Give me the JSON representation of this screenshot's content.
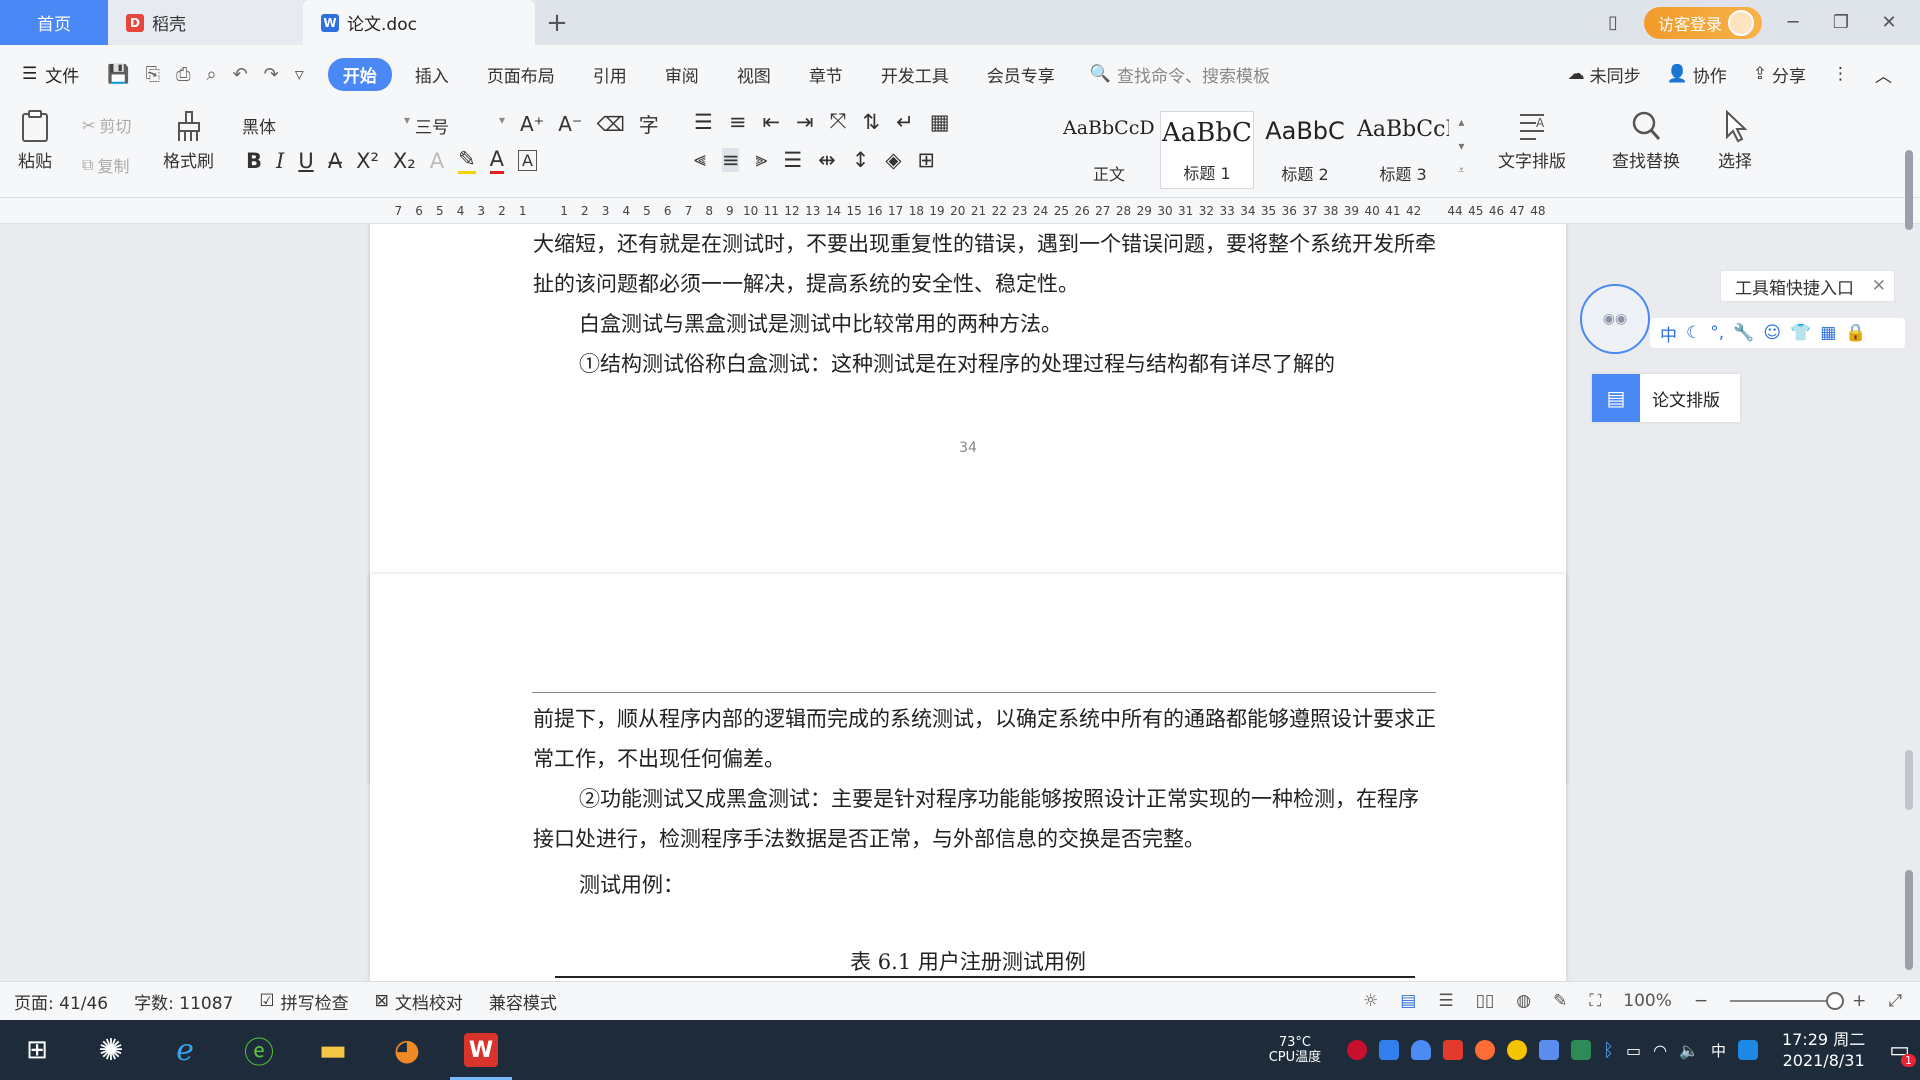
{
  "tabs": {
    "home": "首页",
    "docer": "稻壳",
    "doc": "论文.doc",
    "add": "+",
    "guest_login": "访客登录"
  },
  "menu": {
    "file": "文件",
    "tabs": [
      "开始",
      "插入",
      "页面布局",
      "引用",
      "审阅",
      "视图",
      "章节",
      "开发工具",
      "会员专享"
    ],
    "search_placeholder": "查找命令、搜索模板",
    "unsynced": "未同步",
    "collab": "协作",
    "share": "分享"
  },
  "ribbon": {
    "paste": "粘贴",
    "cut": "剪切",
    "copy": "复制",
    "format_painter": "格式刷",
    "font_name": "黑体",
    "font_size": "三号",
    "styles": [
      {
        "sample": "AaBbCcDc",
        "name": "正文"
      },
      {
        "sample": "AaBbC",
        "name": "标题 1"
      },
      {
        "sample": "AaBbC",
        "name": "标题 2"
      },
      {
        "sample": "AaBbCcI",
        "name": "标题 3"
      }
    ],
    "text_layout": "文字排版",
    "find_replace": "查找替换",
    "select": "选择"
  },
  "ruler": {
    "numbers": [
      "7",
      "6",
      "5",
      "4",
      "3",
      "2",
      "1",
      "",
      "1",
      "2",
      "3",
      "4",
      "5",
      "6",
      "7",
      "8",
      "9",
      "10",
      "11",
      "12",
      "13",
      "14",
      "15",
      "16",
      "17",
      "18",
      "19",
      "20",
      "21",
      "22",
      "23",
      "24",
      "25",
      "26",
      "27",
      "28",
      "29",
      "30",
      "31",
      "32",
      "33",
      "34",
      "35",
      "36",
      "37",
      "38",
      "39",
      "40",
      "41",
      "42",
      "",
      "44",
      "45",
      "46",
      "47",
      "48"
    ]
  },
  "document": {
    "page1_paragraphs": [
      "大缩短，还有就是在测试时，不要出现重复性的错误，遇到一个错误问题，要将整个系统开发所牵扯的该问题都必须一一解决，提高系统的安全性、稳定性。",
      "白盒测试与黑盒测试是测试中比较常用的两种方法。",
      "①结构测试俗称白盒测试：这种测试是在对程序的处理过程与结构都有详尽了解的"
    ],
    "page1_number": "34",
    "page2_paragraphs": [
      "前提下，顺从程序内部的逻辑而完成的系统测试，以确定系统中所有的通路都能够遵照设计要求正常工作，不出现任何偏差。",
      "②功能测试又成黑盒测试：主要是针对程序功能能够按照设计正常实现的一种检测，在程序接口处进行，检测程序手法数据是否正常，与外部信息的交换是否完整。",
      "测试用例："
    ],
    "table_caption": "表 6.1  用户注册测试用例"
  },
  "side_panel": {
    "toolbox_entry": "工具箱快捷入口",
    "icon_bar_first": "中",
    "paper_layout": "论文排版"
  },
  "status": {
    "page": "页面: 41/46",
    "word_count": "字数: 11087",
    "spell_check": "拼写检查",
    "doc_proof": "文档校对",
    "compat_mode": "兼容模式",
    "zoom": "100%"
  },
  "taskbar": {
    "cpu_temp": "73°C",
    "cpu_label": "CPU温度",
    "ime": "中",
    "time": "17:29 周二",
    "date": "2021/8/31",
    "notification_count": "1"
  },
  "colors": {
    "accent": "#4a88f5",
    "guest_orange": "#f39a2a",
    "taskbar_bg": "#1d2b3a"
  }
}
